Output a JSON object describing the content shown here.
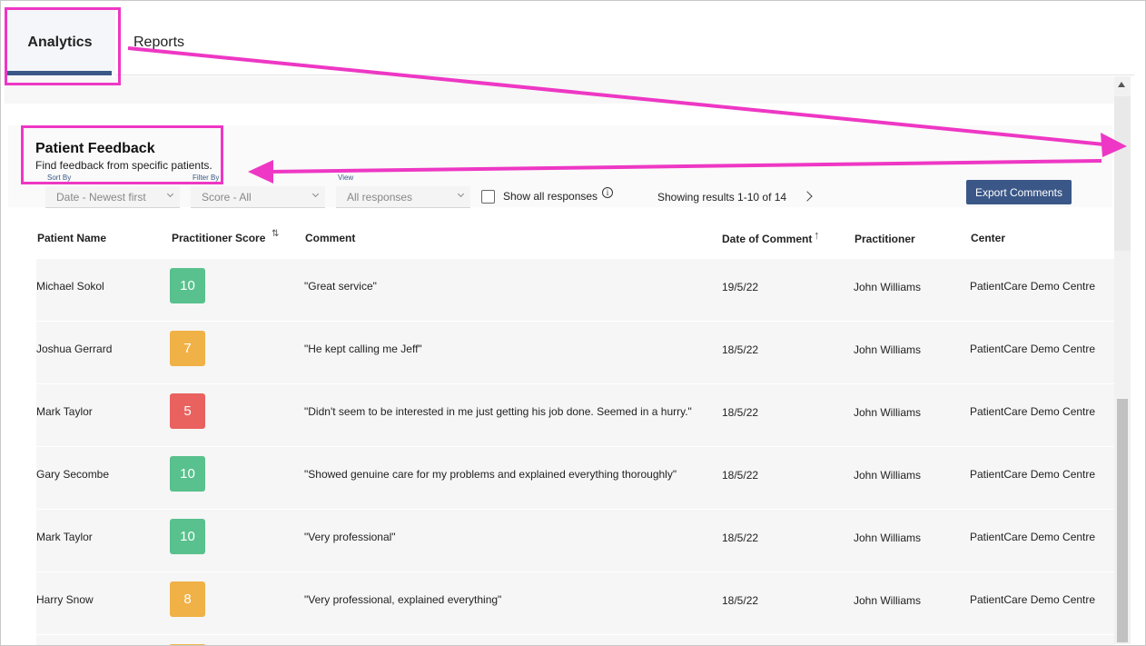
{
  "tabs": [
    {
      "label": "Analytics",
      "active": true
    },
    {
      "label": "Reports",
      "active": false
    }
  ],
  "page": {
    "title": "Patient Feedback",
    "subtitle": "Find feedback from specific patients."
  },
  "filters": {
    "sort_by_label": "Sort By",
    "sort_by_value": "Date - Newest first",
    "filter_by_label": "Filter By",
    "filter_by_value": "Score - All",
    "view_label": "View",
    "view_value": "All responses",
    "show_all_label": "Show all responses",
    "results_text": "Showing results 1-10 of 14",
    "export_label": "Export Comments"
  },
  "table": {
    "headers": {
      "patient": "Patient Name",
      "score": "Practitioner Score",
      "comment": "Comment",
      "date": "Date of Comment",
      "practitioner": "Practitioner",
      "center": "Center"
    },
    "rows": [
      {
        "patient": "Michael Sokol",
        "score": "10",
        "comment": "\"Great service\"",
        "date": "19/5/22",
        "practitioner": "John Williams",
        "center": "PatientCare Demo Centre"
      },
      {
        "patient": "Joshua Gerrard",
        "score": "7",
        "comment": "\"He kept calling me Jeff\"",
        "date": "18/5/22",
        "practitioner": "John Williams",
        "center": "PatientCare Demo Centre"
      },
      {
        "patient": "Mark Taylor",
        "score": "5",
        "comment": "\"Didn't seem to be interested in me just getting his job done. Seemed in a hurry.\"",
        "date": "18/5/22",
        "practitioner": "John Williams",
        "center": "PatientCare Demo Centre"
      },
      {
        "patient": "Gary Secombe",
        "score": "10",
        "comment": "\"Showed genuine care for my problems and explained everything thoroughly\"",
        "date": "18/5/22",
        "practitioner": "John Williams",
        "center": "PatientCare Demo Centre"
      },
      {
        "patient": "Mark Taylor",
        "score": "10",
        "comment": "\"Very professional\"",
        "date": "18/5/22",
        "practitioner": "John Williams",
        "center": "PatientCare Demo Centre"
      },
      {
        "patient": "Harry Snow",
        "score": "8",
        "comment": "\"Very professional, explained everything\"",
        "date": "18/5/22",
        "practitioner": "John Williams",
        "center": "PatientCare Demo Centre"
      }
    ]
  },
  "colors": {
    "accent": "#3a5787",
    "score_high": "#58c18d",
    "score_mid": "#f0b146",
    "score_low": "#e9625f",
    "annotation": "#ee37c4"
  }
}
